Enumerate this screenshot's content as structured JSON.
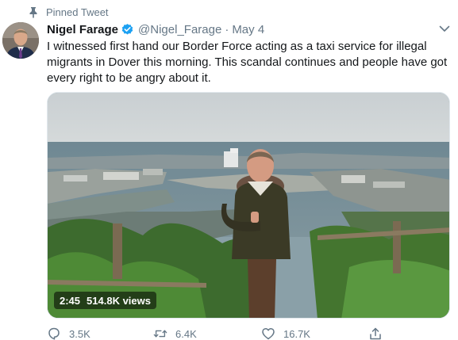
{
  "pinned": {
    "label": "Pinned Tweet",
    "icon": "pin-icon"
  },
  "author": {
    "name": "Nigel Farage",
    "handle": "@Nigel_Farage",
    "separator": "·",
    "date": "May 4",
    "verified": true
  },
  "tweet": {
    "text": "I witnessed first hand our Border Force acting as a taxi service for illegal migrants in Dover this morning. This scandal continues and people have got every right to be angry about it."
  },
  "video": {
    "duration": "2:45",
    "views": "514.8K views"
  },
  "actions": {
    "replies": "3.5K",
    "retweets": "6.4K",
    "likes": "16.7K"
  },
  "colors": {
    "accent": "#1da1f2",
    "muted": "#657786",
    "text": "#14171a"
  }
}
